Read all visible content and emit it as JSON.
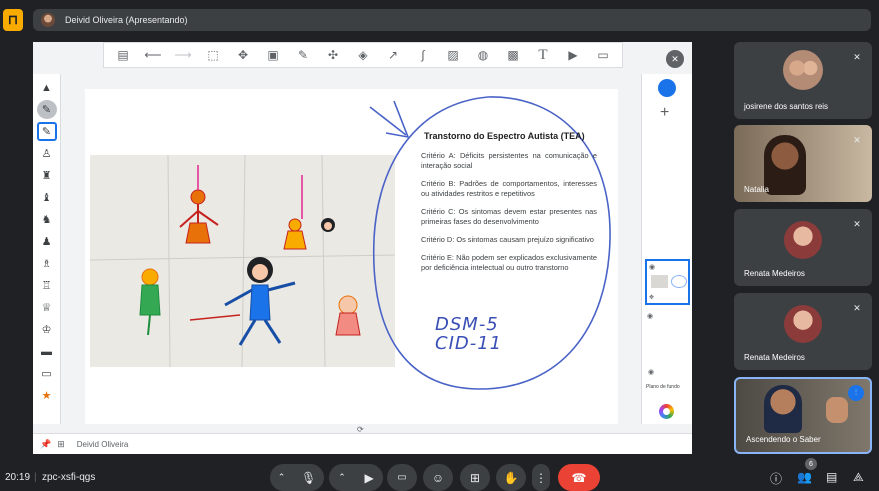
{
  "header": {
    "presenter_label": "Deivid Oliveira (Apresentando)"
  },
  "whiteboard": {
    "slide": {
      "title": "Transtorno do Espectro Autista (TEA)",
      "criteria": [
        "Critério A: Déficits persistentes na comunicação e interação social",
        "Critério B: Padrões de comportamentos, interesses ou atividades restritos e repetitivos",
        "Critério C: Os sintomas devem estar presentes nas primeiras fases do desenvolvimento",
        "Critério D: Os sintomas causam prejuízo significativo",
        "Critério E: Não podem ser explicados exclusivamente por deficiência intelectual ou outro transtorno"
      ],
      "handwriting_line1": "DSM-5",
      "handwriting_line2": "CID-11"
    },
    "background_label": "Plano de fundo",
    "footer_name": "Deivid Oliveira"
  },
  "participants": [
    {
      "name": "josirene dos santos reis"
    },
    {
      "name": "Natalia"
    },
    {
      "name": "Renata Medeiros"
    },
    {
      "name": "Renata Medeiros"
    },
    {
      "name": "Ascendendo o Saber"
    }
  ],
  "bottom_bar": {
    "time": "20:19",
    "meeting_code": "zpc-xsfi-qgs",
    "participant_count": "6"
  }
}
